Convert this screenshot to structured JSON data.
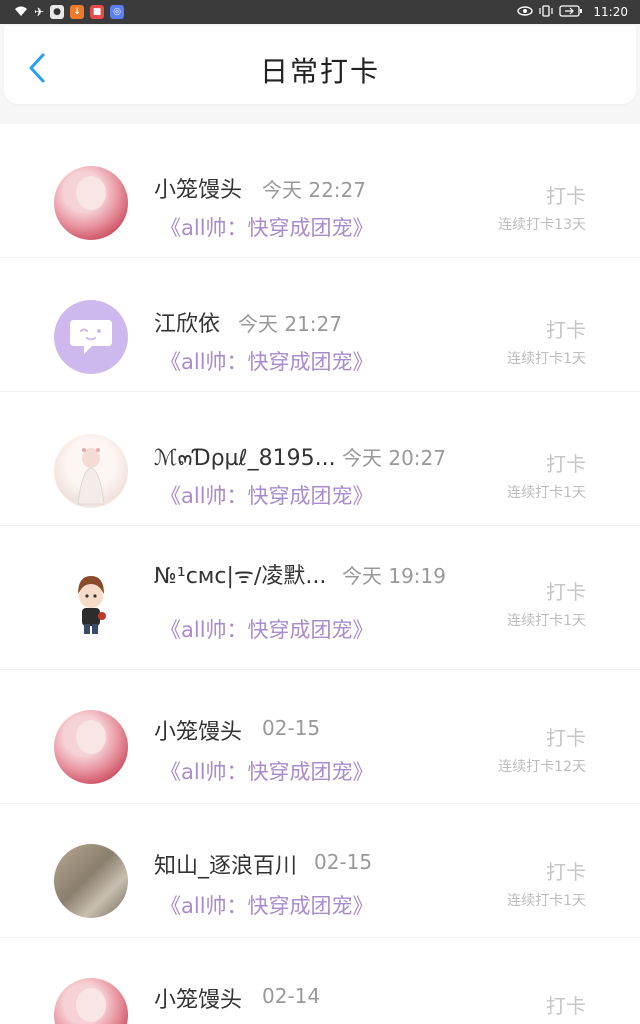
{
  "status_bar": {
    "time": "11:20",
    "left_icons": [
      "wifi-icon",
      "airplane-icon",
      "app-icon-1",
      "app-icon-2",
      "app-icon-3",
      "app-icon-4"
    ],
    "right_icons": [
      "eye-icon",
      "vibrate-icon",
      "battery-icon"
    ]
  },
  "header": {
    "title": "日常打卡"
  },
  "records": [
    {
      "name": "小笼馒头",
      "time": "今天 22:27",
      "book": "《all帅：快穿成团宠》",
      "checkin": "打卡",
      "streak": "连续打卡13天",
      "avatar": "girl-avatar"
    },
    {
      "name": "江欣依",
      "time": "今天 21:27",
      "book": "《all帅：快穿成团宠》",
      "checkin": "打卡",
      "streak": "连续打卡1天",
      "avatar": "chat-bubble-avatar"
    },
    {
      "name": "ℳ๓Ɗρµℓ_8195...",
      "time": "今天 20:27",
      "book": "《all帅：快穿成团宠》",
      "checkin": "打卡",
      "streak": "连续打卡1天",
      "avatar": "bride-avatar"
    },
    {
      "name": "№¹смс|ᯤ∕凌默...",
      "time": "今天 19:19",
      "book": "《all帅：快穿成团宠》",
      "checkin": "打卡",
      "streak": "连续打卡1天",
      "avatar": "boy-avatar"
    },
    {
      "name": "小笼馒头",
      "time": "02-15",
      "book": "《all帅：快穿成团宠》",
      "checkin": "打卡",
      "streak": "连续打卡12天",
      "avatar": "girl-avatar"
    },
    {
      "name": "知山_逐浪百川",
      "time": "02-15",
      "book": "《all帅：快穿成团宠》",
      "checkin": "打卡",
      "streak": "连续打卡1天",
      "avatar": "wall-avatar"
    },
    {
      "name": "小笼馒头",
      "time": "02-14",
      "book": "",
      "checkin": "打卡",
      "streak": "",
      "avatar": "girl-avatar"
    }
  ],
  "colors": {
    "accent": "#2a9df4",
    "book_title": "#a98ccc",
    "status_bar": "#3b3b3b"
  }
}
